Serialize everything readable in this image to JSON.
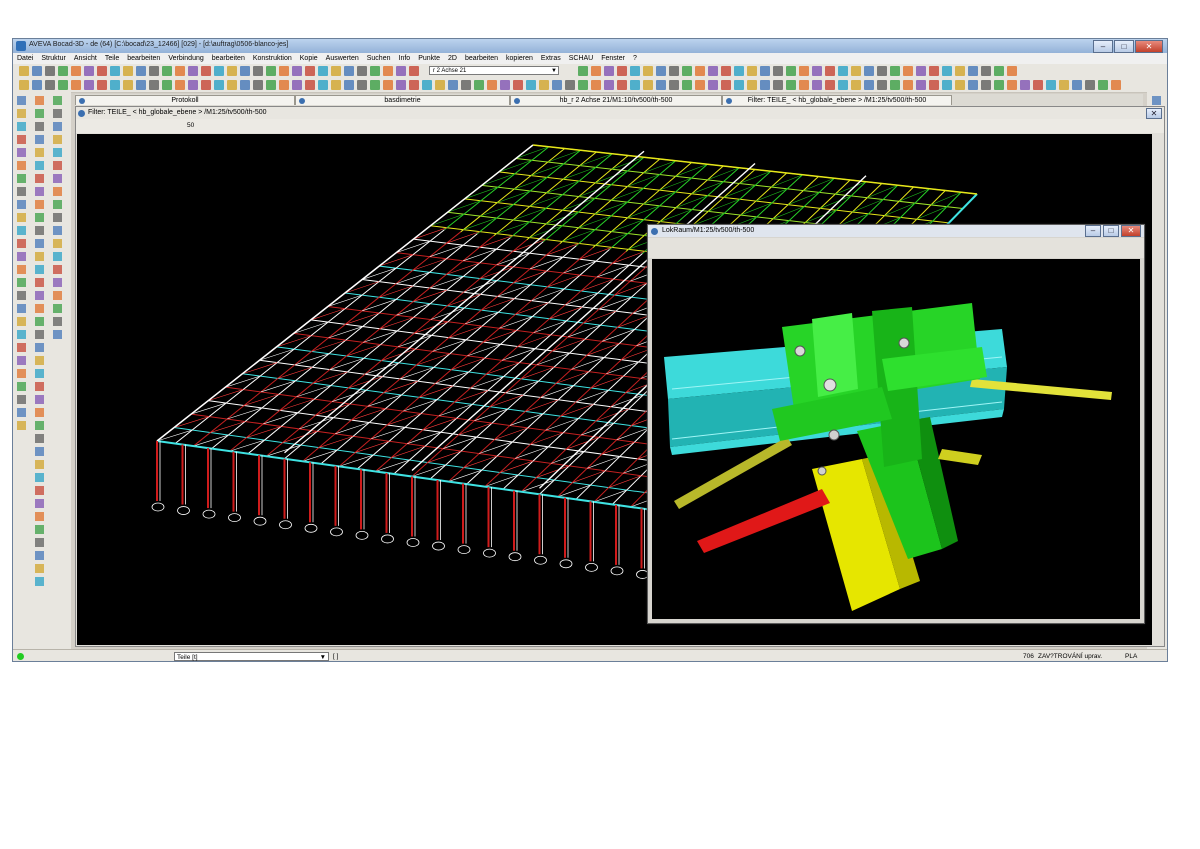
{
  "window": {
    "title": "AVEVA Bocad-3D - de (64) [C:\\bocad\\23_12466] [029] - [d:\\auftrag\\0506-blanco-jes]"
  },
  "menu": [
    "Datei",
    "Struktur",
    "Ansicht",
    "Teile",
    "bearbeiten",
    "Verbindung",
    "bearbeiten",
    "Konstruktion",
    "Kopie",
    "Auswerten",
    "Suchen",
    "Info",
    "Punkte",
    "2D",
    "bearbeiten",
    "kopieren",
    "Extras",
    "SCHAU",
    "Fenster",
    "?"
  ],
  "toolbar": {
    "combo_value": "r 2 Achse 21"
  },
  "tabs": [
    "Protokoll",
    "basdimetrie",
    "hb_r 2 Achse 21/M1:10/tv500/th-500",
    "Filter: TEILE_ < hb_globale_ebene > /M1:25/tv500/th-500"
  ],
  "main_view": {
    "title": "Filter: TEILE_ < hb_globale_ebene > /M1:25/tv500/th-500",
    "zoom_value": "50"
  },
  "popup": {
    "title": "LokRaum/M1:25/tv500/th-500"
  },
  "status": {
    "layer_combo": "Teile [t]",
    "bracket": "[ ]",
    "count": "706",
    "message": "ZAV?TROVÁNÍ uprav.",
    "mode": "PLA"
  },
  "colors": {
    "background": "#000000",
    "cyan": "#3fe3e3",
    "red": "#c01818",
    "white": "#ffffff",
    "green": "#28d028",
    "yellow": "#e8e800",
    "lime": "#7ddc3a"
  }
}
